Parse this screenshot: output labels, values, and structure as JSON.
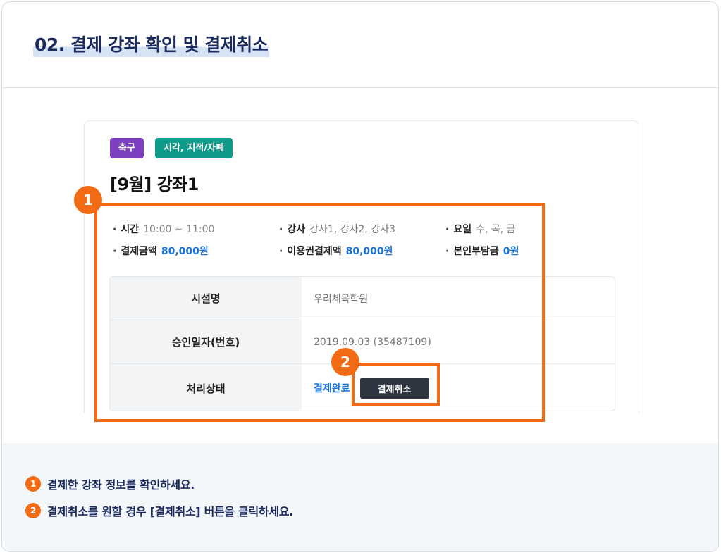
{
  "section_title": "02. 결제 강좌 확인 및 결제취소",
  "tags": [
    {
      "label": "축구",
      "color": "#7b3fbf"
    },
    {
      "label": "시각, 지적/자폐",
      "color": "#0f9b8a"
    }
  ],
  "course_title": "[9월] 강좌1",
  "info": {
    "time_label": "시간",
    "time_value": "10:00 ~ 11:00",
    "teacher_label": "강사",
    "teachers": [
      "강사1",
      "강사2",
      "강사3"
    ],
    "days_label": "요일",
    "days_value": "수, 목, 금",
    "pay_label": "결제금액",
    "pay_value": "80,000원",
    "voucher_label": "이용권결제액",
    "voucher_value": "80,000원",
    "self_label": "본인부담금",
    "self_value": "0원"
  },
  "table": {
    "facility_label": "시설명",
    "facility_value": "우리체육학원",
    "approval_label": "승인일자(번호)",
    "approval_value": "2019.09.03 (35487109)",
    "status_label": "처리상태",
    "status_value": "결제완료",
    "cancel_button": "결제취소"
  },
  "badges": [
    "1",
    "2"
  ],
  "steps": [
    {
      "num": "1",
      "text": "결제한 강좌 정보를 확인하세요."
    },
    {
      "num": "2",
      "text": "결제취소를 원할 경우 [결제취소] 버튼을 클릭하세요."
    }
  ],
  "colors": {
    "accent": "#f26a13",
    "link": "#1a73d9",
    "title": "#1b2a5c"
  }
}
